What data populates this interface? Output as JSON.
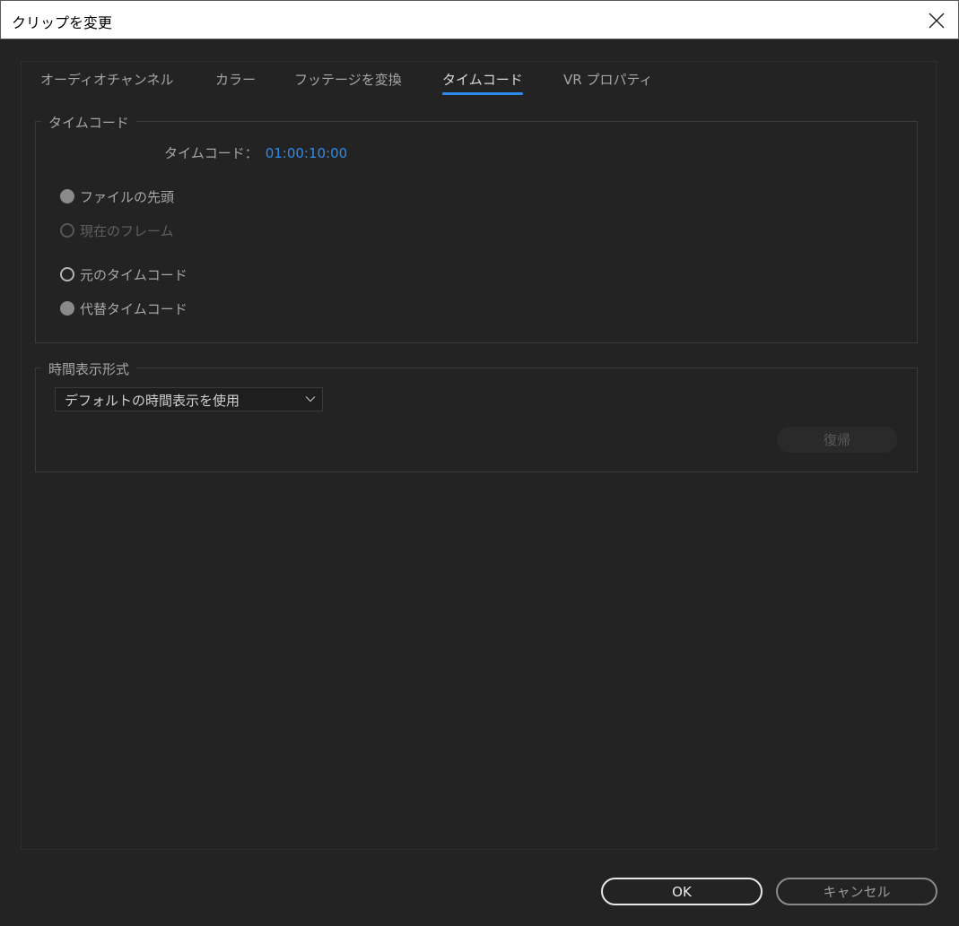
{
  "window": {
    "title": "クリップを変更",
    "close_icon": "close-icon"
  },
  "tabs": [
    {
      "label": "オーディオチャンネル",
      "active": false
    },
    {
      "label": "カラー",
      "active": false
    },
    {
      "label": "フッテージを変換",
      "active": false
    },
    {
      "label": "タイムコード",
      "active": true
    },
    {
      "label": "VR プロパティ",
      "active": false
    }
  ],
  "timecode_group": {
    "legend": "タイムコード",
    "timecode_label": "タイムコード：",
    "timecode_value": "01:00:10:00",
    "options": [
      {
        "label": "ファイルの先頭",
        "state": "selected"
      },
      {
        "label": "現在のフレーム",
        "state": "disabled"
      },
      {
        "label": "元のタイムコード",
        "state": "unselected"
      },
      {
        "label": "代替タイムコード",
        "state": "selected"
      }
    ]
  },
  "time_display_group": {
    "legend": "時間表示形式",
    "dropdown_value": "デフォルトの時間表示を使用",
    "reset_label": "復帰"
  },
  "footer": {
    "ok_label": "OK",
    "cancel_label": "キャンセル"
  },
  "colors": {
    "background": "#232323",
    "accent": "#2d8ceb",
    "text": "#a6a6a6"
  }
}
